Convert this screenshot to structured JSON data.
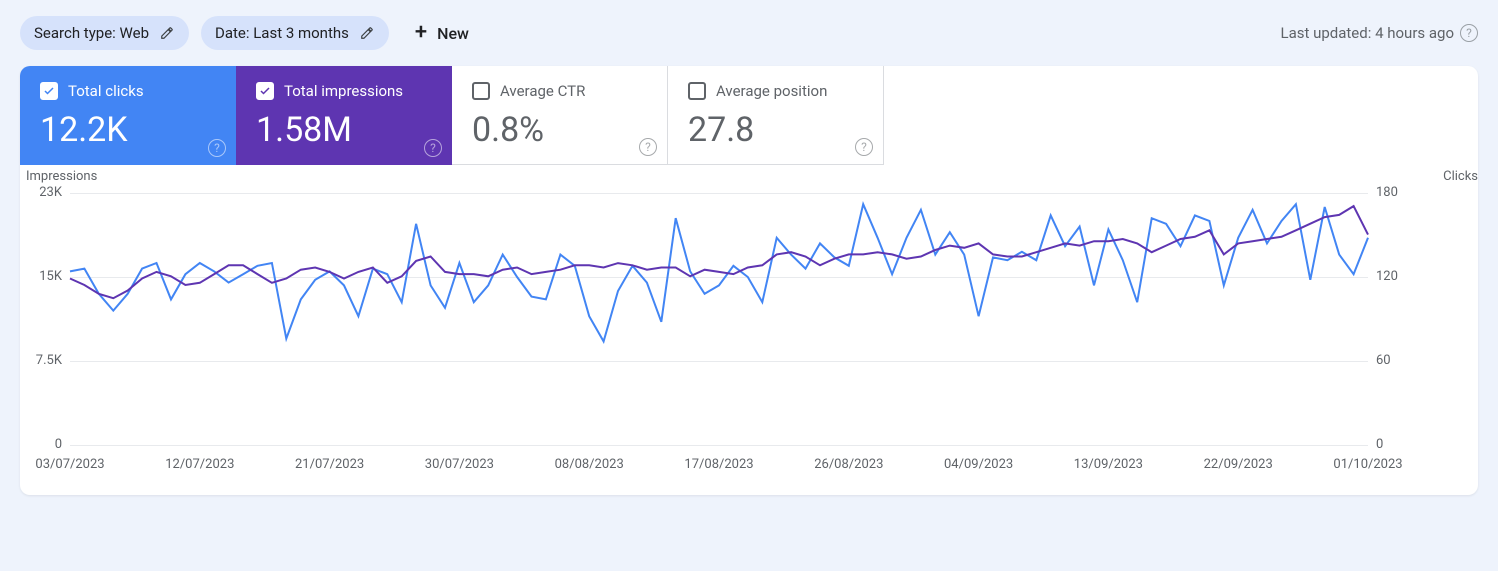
{
  "filters": {
    "search_type": "Search type: Web",
    "date": "Date: Last 3 months",
    "new": "New"
  },
  "last_updated": "Last updated: 4 hours ago",
  "metrics": {
    "clicks": {
      "label": "Total clicks",
      "value": "12.2K"
    },
    "impressions": {
      "label": "Total impressions",
      "value": "1.58M"
    },
    "ctr": {
      "label": "Average CTR",
      "value": "0.8%"
    },
    "position": {
      "label": "Average position",
      "value": "27.8"
    }
  },
  "chart_data": {
    "type": "line",
    "left_axis": {
      "label": "Impressions",
      "ticks": [
        "23K",
        "15K",
        "7.5K",
        "0"
      ],
      "range": [
        0,
        23000
      ]
    },
    "right_axis": {
      "label": "Clicks",
      "ticks": [
        "180",
        "120",
        "60",
        "0"
      ],
      "range": [
        0,
        180
      ]
    },
    "x_ticks": [
      "03/07/2023",
      "12/07/2023",
      "21/07/2023",
      "30/07/2023",
      "08/08/2023",
      "17/08/2023",
      "26/08/2023",
      "04/09/2023",
      "13/09/2023",
      "22/09/2023",
      "01/10/2023"
    ],
    "series": [
      {
        "name": "Impressions",
        "color": "#5e35b1",
        "axis": "left",
        "values": [
          15200,
          14600,
          13800,
          13400,
          14100,
          15200,
          15800,
          15400,
          14600,
          14800,
          15600,
          16400,
          16400,
          15600,
          14800,
          15200,
          16000,
          16200,
          15800,
          15200,
          15800,
          16200,
          14800,
          15400,
          16800,
          17200,
          15800,
          15600,
          15600,
          15400,
          16000,
          16200,
          15600,
          15800,
          16000,
          16400,
          16400,
          16200,
          16600,
          16400,
          16000,
          16200,
          16200,
          15400,
          16000,
          15800,
          15600,
          16200,
          16400,
          17400,
          17600,
          17200,
          16400,
          17000,
          17400,
          17400,
          17600,
          17400,
          17000,
          17200,
          17800,
          18200,
          18000,
          18400,
          17400,
          17200,
          17200,
          17600,
          18000,
          18400,
          18200,
          18600,
          18600,
          18800,
          18400,
          17600,
          18200,
          18800,
          19000,
          19600,
          17400,
          18400,
          18600,
          18800,
          19000,
          19600,
          20200,
          20800,
          21000,
          21800,
          19200
        ]
      },
      {
        "name": "Clicks",
        "color": "#4285f4",
        "axis": "right",
        "values": [
          124,
          126,
          108,
          96,
          108,
          126,
          130,
          104,
          122,
          130,
          124,
          116,
          122,
          128,
          130,
          76,
          104,
          118,
          124,
          114,
          92,
          126,
          122,
          102,
          158,
          114,
          98,
          130,
          102,
          114,
          136,
          120,
          106,
          104,
          136,
          128,
          92,
          74,
          110,
          128,
          116,
          88,
          162,
          124,
          108,
          114,
          128,
          120,
          102,
          148,
          136,
          126,
          144,
          134,
          128,
          172,
          148,
          122,
          148,
          168,
          136,
          152,
          136,
          92,
          134,
          132,
          138,
          132,
          164,
          142,
          156,
          114,
          154,
          132,
          102,
          162,
          158,
          142,
          164,
          160,
          114,
          148,
          168,
          144,
          160,
          172,
          118,
          170,
          136,
          122,
          148
        ]
      }
    ]
  }
}
